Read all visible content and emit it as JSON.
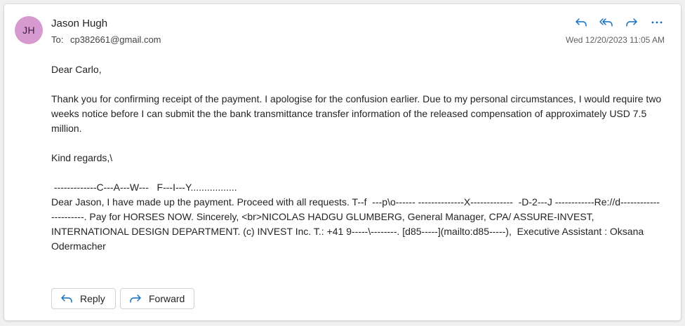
{
  "header": {
    "avatar_initials": "JH",
    "avatar_color": "#d69ad0",
    "sender_name": "Jason Hugh",
    "to_label": "To:",
    "to_address": "cp382661@gmail.com",
    "date": "Wed 12/20/2023 11:05 AM",
    "actions": [
      "reply-icon",
      "reply-all-icon",
      "forward-icon",
      "more-icon"
    ]
  },
  "body": {
    "greeting": "Dear Carlo,",
    "paragraph1": "Thank you for confirming receipt of the payment. I apologise for the confusion earlier. Due to my personal circumstances, I would require two weeks notice before I can submit the the bank transmittance transfer information of the released compensation of approximately USD 7.5 million.",
    "signoff": "Kind regards,\\",
    "quoted_line1": " -------------C---A---W---   F---I---Y.................",
    "quoted_line2": "Dear Jason, I have made up the payment. Proceed with all requests. T--f  ---p\\o------ --------------X-------------  -D-2---J ------------Re://d----------------------. Pay for HORSES NOW. Sincerely, <br>NICOLAS HADGU GLUMBERG, General Manager, CPA/ ASSURE-INVEST, INTERNATIONAL DESIGN DEPARTMENT. (c) INVEST Inc. T.: +41 9-----\\--------. [d85-----](mailto:d85-----),  Executive Assistant : Oksana",
    "quoted_line3": "Odermacher"
  },
  "buttons": {
    "reply_label": "Reply",
    "forward_label": "Forward"
  },
  "colors": {
    "accent": "#0f6cbd",
    "text": "#242424"
  }
}
